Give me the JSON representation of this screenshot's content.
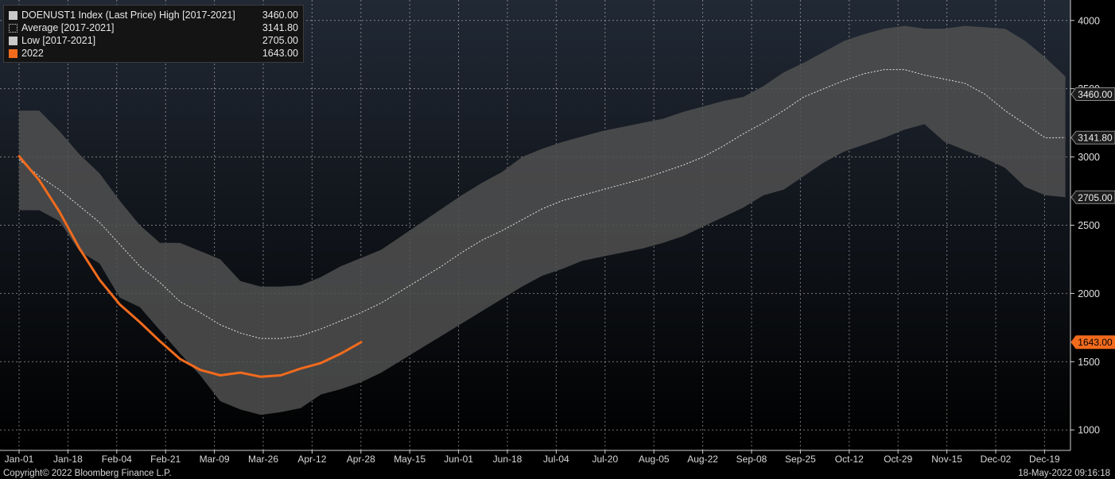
{
  "chart_data": {
    "type": "area",
    "x": [
      "Jan-01",
      "Jan-18",
      "Feb-04",
      "Feb-21",
      "Mar-09",
      "Mar-26",
      "Apr-12",
      "Apr-28",
      "May-15",
      "Jun-01",
      "Jun-18",
      "Jul-04",
      "Jul-20",
      "Aug-05",
      "Aug-22",
      "Sep-08",
      "Sep-25",
      "Oct-12",
      "Oct-29",
      "Nov-15",
      "Dec-02",
      "Dec-19"
    ],
    "x_tick_labels": [
      "Jan-01",
      "Jan-18",
      "Feb-04",
      "Feb-21",
      "Mar-09",
      "Mar-26",
      "Apr-12",
      "Apr-28",
      "May-15",
      "Jun-01",
      "Jun-18",
      "Jul-04",
      "Jul-20",
      "Aug-05",
      "Aug-22",
      "Sep-08",
      "Sep-25",
      "Oct-12",
      "Oct-29",
      "Nov-15",
      "Dec-02",
      "Dec-19"
    ],
    "y_tick_labels": [
      "1000",
      "1500",
      "2000",
      "2500",
      "3000",
      "3500",
      "4000"
    ],
    "ylim": [
      850,
      4150
    ],
    "grid": true,
    "legend_position": "top-left",
    "weeks": [
      0,
      1,
      2,
      3,
      4,
      5,
      6,
      7,
      8,
      9,
      10,
      11,
      12,
      13,
      14,
      15,
      16,
      17,
      18,
      19,
      20,
      21,
      22,
      23,
      24,
      25,
      26,
      27,
      28,
      29,
      30,
      31,
      32,
      33,
      34,
      35,
      36,
      37,
      38,
      39,
      40,
      41,
      42,
      43,
      44,
      45,
      46,
      47,
      48,
      49,
      50,
      51,
      52
    ],
    "series": [
      {
        "name": "DOENUST1 Index (Last Price) High [2017-2021]",
        "role": "high",
        "value_label": "3460.00",
        "values": [
          3340,
          3340,
          3190,
          3020,
          2880,
          2680,
          2500,
          2370,
          2370,
          2310,
          2250,
          2090,
          2050,
          2050,
          2060,
          2120,
          2200,
          2260,
          2320,
          2420,
          2520,
          2620,
          2720,
          2810,
          2890,
          3000,
          3060,
          3110,
          3150,
          3190,
          3220,
          3250,
          3280,
          3330,
          3370,
          3410,
          3440,
          3520,
          3620,
          3690,
          3770,
          3850,
          3900,
          3940,
          3960,
          3940,
          3940,
          3960,
          3950,
          3940,
          3850,
          3730,
          3590
        ]
      },
      {
        "name": "Average [2017-2021]",
        "role": "average",
        "value_label": "3141.80",
        "values": [
          2980,
          2860,
          2760,
          2640,
          2520,
          2360,
          2200,
          2080,
          1940,
          1860,
          1770,
          1710,
          1670,
          1670,
          1690,
          1740,
          1800,
          1860,
          1930,
          2020,
          2110,
          2200,
          2300,
          2390,
          2460,
          2540,
          2620,
          2680,
          2720,
          2760,
          2800,
          2840,
          2890,
          2940,
          3000,
          3080,
          3170,
          3250,
          3340,
          3440,
          3500,
          3560,
          3610,
          3640,
          3640,
          3600,
          3570,
          3540,
          3460,
          3340,
          3240,
          3140,
          3141.8
        ]
      },
      {
        "name": "Low [2017-2021]",
        "role": "low",
        "value_label": "2705.00",
        "values": [
          2610,
          2610,
          2530,
          2310,
          2220,
          1970,
          1900,
          1730,
          1560,
          1400,
          1210,
          1150,
          1110,
          1130,
          1160,
          1260,
          1300,
          1350,
          1420,
          1510,
          1600,
          1690,
          1780,
          1870,
          1960,
          2050,
          2130,
          2180,
          2240,
          2270,
          2300,
          2330,
          2370,
          2420,
          2490,
          2560,
          2630,
          2720,
          2760,
          2860,
          2960,
          3040,
          3090,
          3140,
          3200,
          3240,
          3110,
          3050,
          2990,
          2920,
          2780,
          2720,
          2705
        ]
      },
      {
        "name": "2022",
        "role": "current",
        "value_label": "1643.00",
        "values": [
          3005,
          2830,
          2600,
          2330,
          2100,
          1920,
          1790,
          1650,
          1520,
          1440,
          1400,
          1420,
          1390,
          1400,
          1450,
          1490,
          1560,
          1643
        ]
      }
    ],
    "axis_tags": [
      {
        "series": "high",
        "text": "3460.00",
        "value": 3460
      },
      {
        "series": "average",
        "text": "3141.80",
        "value": 3141.8
      },
      {
        "series": "low",
        "text": "2705.00",
        "value": 2705
      },
      {
        "series": "current",
        "text": "1643.00",
        "value": 1643
      }
    ]
  },
  "colors": {
    "background": "#000000",
    "plot_top": "#212935",
    "plot_bottom": "#000000",
    "band": "#505050",
    "average": "#e0e0e0",
    "current": "#f26b1d",
    "grid": "#cfcfcf",
    "tag_bg": "#1c1c1c"
  },
  "footer": {
    "copyright": "Copyright© 2022 Bloomberg Finance L.P.",
    "timestamp": "18-May-2022 09:16:18"
  }
}
